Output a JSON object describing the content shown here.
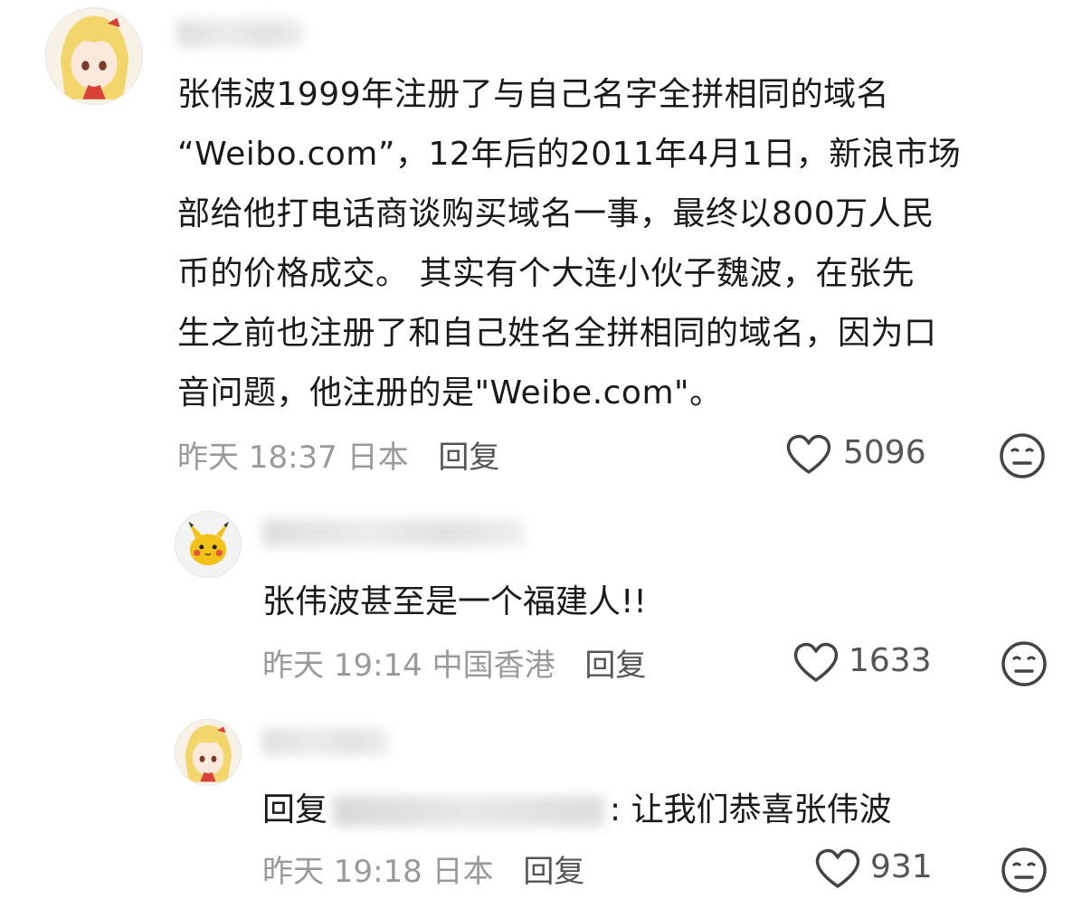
{
  "comments": [
    {
      "text_lines": [
        "张伟波1999年注册了与自己名字全拼相同的域名",
        "“Weibo.com”，12年后的2011年4月1日，新浪市场",
        "部给他打电话商谈购买域名一事，最终以800万人民",
        "币的价格成交。 其实有个大连小伙子魏波，在张先",
        "生之前也注册了和自己姓名全拼相同的域名，因为口",
        "音问题，他注册的是\"Weibe.com\"。"
      ],
      "time": "昨天 18:37",
      "location": "日本",
      "reply_label": "回复",
      "likes": "5096"
    },
    {
      "text": "张伟波甚至是一个福建人!!",
      "time": "昨天 19:14",
      "location": "中国香港",
      "reply_label": "回复",
      "likes": "1633"
    },
    {
      "reply_prefix": "回复",
      "text": ": 让我们恭喜张伟波",
      "time": "昨天 19:18",
      "location": "日本",
      "reply_label": "回复",
      "likes": "931"
    }
  ],
  "icons": {
    "like": "heart-outline-icon",
    "emoji": "neutral-face-icon"
  },
  "colors": {
    "text": "#1a1a1a",
    "meta": "#9a9a9a",
    "icon": "#444444"
  }
}
